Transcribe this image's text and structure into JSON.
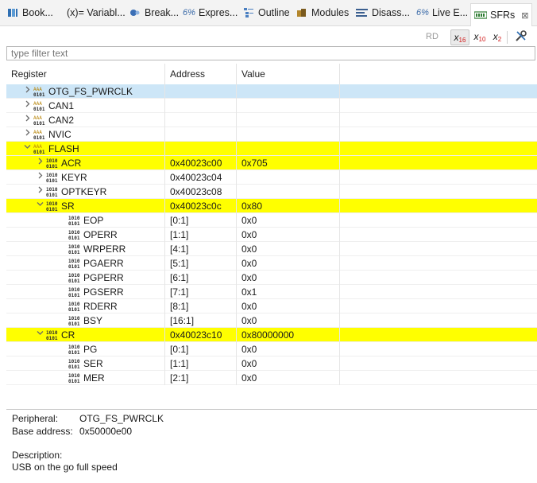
{
  "tabs": [
    {
      "label": "Book...",
      "icon": "bookmarks-icon"
    },
    {
      "label": "(x)= Variabl...",
      "icon": "variables-icon"
    },
    {
      "label": "Break...",
      "icon": "breakpoints-icon"
    },
    {
      "label": "Expres...",
      "icon": "expressions-icon"
    },
    {
      "label": "Outline",
      "icon": "outline-icon"
    },
    {
      "label": "Modules",
      "icon": "modules-icon"
    },
    {
      "label": "Disass...",
      "icon": "disassembly-icon"
    },
    {
      "label": "Live E...",
      "icon": "live-expressions-icon"
    },
    {
      "label": "SFRs",
      "icon": "sfrs-icon",
      "close": "⊠"
    }
  ],
  "toolbar": {
    "rd": "RD",
    "x16": "x",
    "x16_sub": "16",
    "x10": "x",
    "x10_sub": "10",
    "x2": "x",
    "x2_sub": "2"
  },
  "filter": {
    "placeholder": "type filter text"
  },
  "columns": [
    "Register",
    "Address",
    "Value"
  ],
  "rows": [
    {
      "name": "OTG_FS_PWRCLK",
      "address": "",
      "value": "",
      "level": 1,
      "type": "peripheral",
      "twisty": ">",
      "style": "sel"
    },
    {
      "name": "CAN1",
      "address": "",
      "value": "",
      "level": 1,
      "type": "peripheral",
      "twisty": ">",
      "style": ""
    },
    {
      "name": "CAN2",
      "address": "",
      "value": "",
      "level": 1,
      "type": "peripheral",
      "twisty": ">",
      "style": ""
    },
    {
      "name": "NVIC",
      "address": "",
      "value": "",
      "level": 1,
      "type": "peripheral",
      "twisty": ">",
      "style": ""
    },
    {
      "name": "FLASH",
      "address": "",
      "value": "",
      "level": 1,
      "type": "peripheral",
      "twisty": "v",
      "style": "hl"
    },
    {
      "name": "ACR",
      "address": "0x40023c00",
      "value": "0x705",
      "level": 2,
      "type": "register",
      "twisty": ">",
      "style": "hl"
    },
    {
      "name": "KEYR",
      "address": "0x40023c04",
      "value": "",
      "level": 2,
      "type": "register",
      "twisty": ">",
      "style": ""
    },
    {
      "name": "OPTKEYR",
      "address": "0x40023c08",
      "value": "",
      "level": 2,
      "type": "register",
      "twisty": ">",
      "style": ""
    },
    {
      "name": "SR",
      "address": "0x40023c0c",
      "value": "0x80",
      "level": 2,
      "type": "register",
      "twisty": "v",
      "style": "hl"
    },
    {
      "name": "EOP",
      "address": "[0:1]",
      "value": "0x0",
      "level": 3,
      "type": "field",
      "twisty": "",
      "style": ""
    },
    {
      "name": "OPERR",
      "address": "[1:1]",
      "value": "0x0",
      "level": 3,
      "type": "field",
      "twisty": "",
      "style": ""
    },
    {
      "name": "WRPERR",
      "address": "[4:1]",
      "value": "0x0",
      "level": 3,
      "type": "field",
      "twisty": "",
      "style": ""
    },
    {
      "name": "PGAERR",
      "address": "[5:1]",
      "value": "0x0",
      "level": 3,
      "type": "field",
      "twisty": "",
      "style": ""
    },
    {
      "name": "PGPERR",
      "address": "[6:1]",
      "value": "0x0",
      "level": 3,
      "type": "field",
      "twisty": "",
      "style": ""
    },
    {
      "name": "PGSERR",
      "address": "[7:1]",
      "value": "0x1",
      "level": 3,
      "type": "field",
      "twisty": "",
      "style": ""
    },
    {
      "name": "RDERR",
      "address": "[8:1]",
      "value": "0x0",
      "level": 3,
      "type": "field",
      "twisty": "",
      "style": ""
    },
    {
      "name": "BSY",
      "address": "[16:1]",
      "value": "0x0",
      "level": 3,
      "type": "field",
      "twisty": "",
      "style": ""
    },
    {
      "name": "CR",
      "address": "0x40023c10",
      "value": "0x80000000",
      "level": 2,
      "type": "register",
      "twisty": "v",
      "style": "hl"
    },
    {
      "name": "PG",
      "address": "[0:1]",
      "value": "0x0",
      "level": 3,
      "type": "field",
      "twisty": "",
      "style": ""
    },
    {
      "name": "SER",
      "address": "[1:1]",
      "value": "0x0",
      "level": 3,
      "type": "field",
      "twisty": "",
      "style": ""
    },
    {
      "name": "MER",
      "address": "[2:1]",
      "value": "0x0",
      "level": 3,
      "type": "field",
      "twisty": "",
      "style": ""
    }
  ],
  "details": {
    "peripheral_label": "Peripheral:",
    "peripheral_value": "OTG_FS_PWRCLK",
    "base_label": "Base address:",
    "base_value": "0x50000e00",
    "description_label": "Description:",
    "description_value": "USB on the go full speed"
  },
  "colors": {
    "highlight": "#ffff00",
    "selection": "#cde6f7",
    "peripheral_icon": "#b8860b",
    "register_icon": "#2d2d2d"
  }
}
